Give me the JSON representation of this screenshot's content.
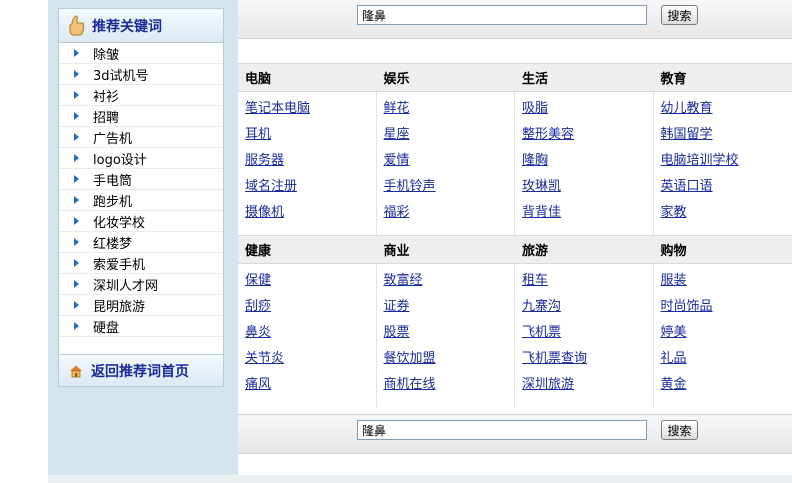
{
  "sidebar": {
    "title": "推荐关键词",
    "items": [
      "除皱",
      "3d试机号",
      "衬衫",
      "招聘",
      "广告机",
      "logo设计",
      "手电筒",
      "跑步机",
      "化妆学校",
      "红楼梦",
      "索爱手机",
      "深圳人才网",
      "昆明旅游",
      "硬盘"
    ],
    "footer": "返回推荐词首页"
  },
  "search_top": {
    "value": "隆鼻",
    "button": "搜索"
  },
  "search_bottom": {
    "value": "隆鼻",
    "button": "搜索"
  },
  "sections": [
    {
      "columns": [
        {
          "category": "电脑",
          "links": [
            "笔记本电脑",
            "耳机",
            "服务器",
            "域名注册",
            "摄像机"
          ]
        },
        {
          "category": "娱乐",
          "links": [
            "鲜花",
            "星座",
            "爱情",
            "手机铃声",
            "福彩"
          ]
        },
        {
          "category": "生活",
          "links": [
            "吸脂",
            "整形美容",
            "隆胸",
            "玫琳凯",
            "背背佳"
          ]
        },
        {
          "category": "教育",
          "links": [
            "幼儿教育",
            "韩国留学",
            "电脑培训学校",
            "英语口语",
            "家教"
          ]
        }
      ]
    },
    {
      "columns": [
        {
          "category": "健康",
          "links": [
            "保健",
            "刮痧",
            "鼻炎",
            "关节炎",
            "痛风"
          ]
        },
        {
          "category": "商业",
          "links": [
            "致富经",
            "证券",
            "股票",
            "餐饮加盟",
            "商机在线"
          ]
        },
        {
          "category": "旅游",
          "links": [
            "租车",
            "九寨沟",
            "飞机票",
            "飞机票查询",
            "深圳旅游"
          ]
        },
        {
          "category": "购物",
          "links": [
            "服装",
            "时尚饰品",
            "婷美",
            "礼品",
            "黄金"
          ]
        }
      ]
    }
  ]
}
